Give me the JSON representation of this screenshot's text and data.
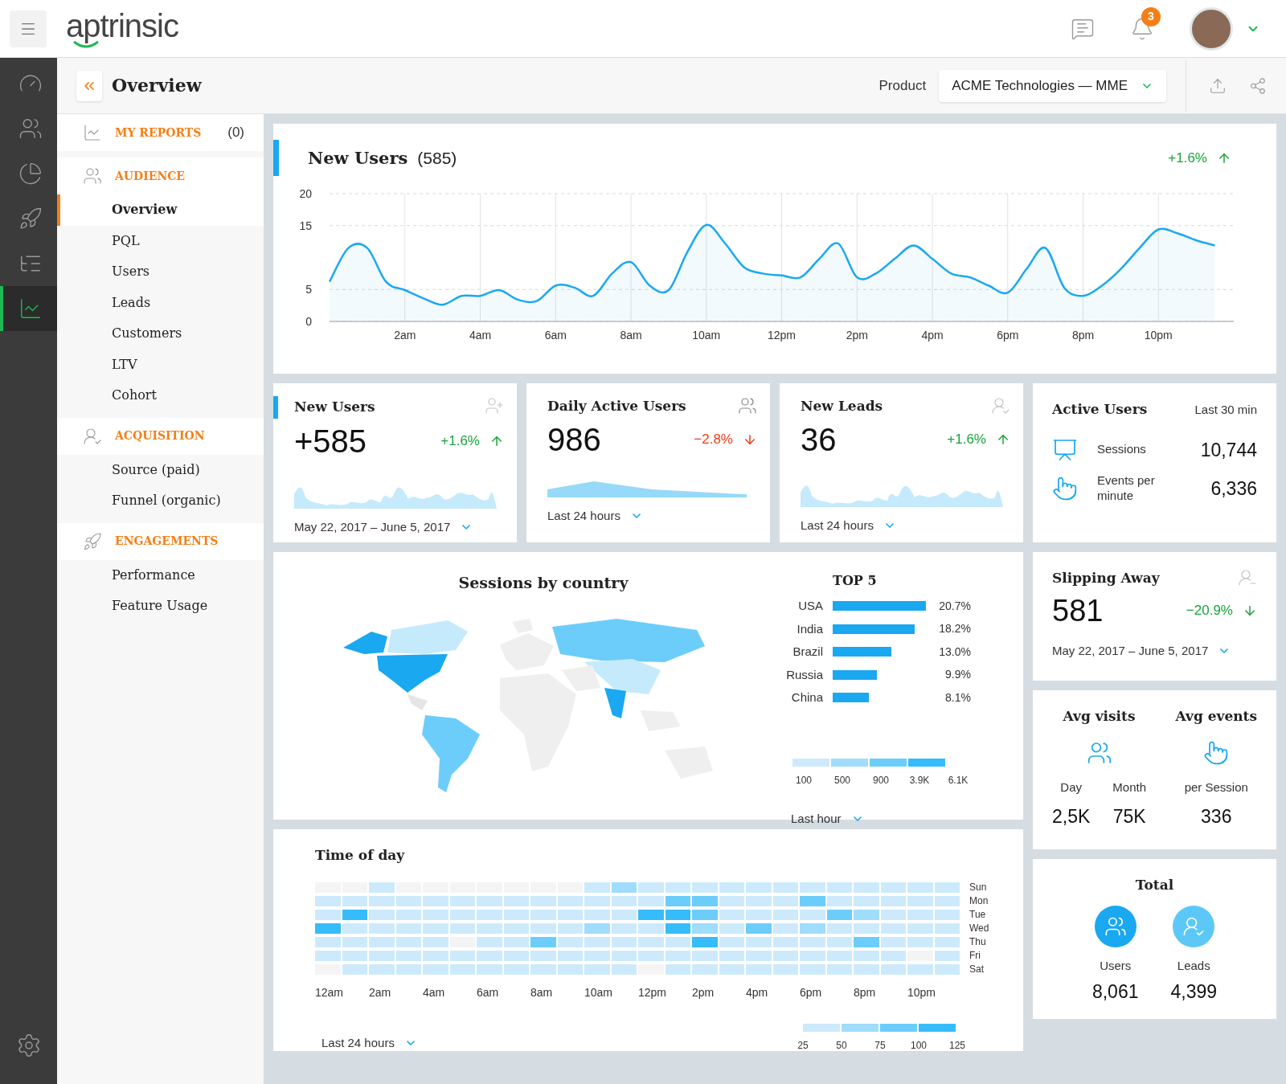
{
  "header": {
    "logo": "aptrinsic",
    "notifications": "3"
  },
  "rail": [
    {
      "selected": false
    },
    {
      "selected": false
    },
    {
      "selected": false
    },
    {
      "selected": false
    },
    {
      "selected": false
    },
    {
      "selected": true
    }
  ],
  "subheader": {
    "title": "Overview",
    "product_label": "Product",
    "product": "ACME Technologies — MME"
  },
  "nav": [
    {
      "label": "MY REPORTS",
      "count": "(0)"
    },
    {
      "label": "AUDIENCE",
      "items": [
        {
          "label": "Overview",
          "selected": true
        },
        {
          "label": "PQL",
          "selected": false
        },
        {
          "label": "Users",
          "selected": false
        },
        {
          "label": "Leads",
          "selected": false
        },
        {
          "label": "Customers",
          "selected": false
        },
        {
          "label": "LTV",
          "selected": false
        },
        {
          "label": "Cohort",
          "selected": false
        }
      ]
    },
    {
      "label": "ACQUISITION",
      "items": [
        {
          "label": "Source (paid)",
          "selected": false
        },
        {
          "label": "Funnel (organic)",
          "selected": false
        }
      ]
    },
    {
      "label": "ENGAGEMENTS",
      "items": [
        {
          "label": "Performance",
          "selected": false
        },
        {
          "label": "Feature Usage",
          "selected": false
        }
      ]
    }
  ],
  "main_chart": {
    "title": "New Users",
    "count": "(585)",
    "delta": "+1.6%",
    "rising": true,
    "good": true,
    "chart_data": {
      "type": "area",
      "categories": [
        null,
        null,
        null,
        null,
        "2am",
        null,
        null,
        null,
        "4am",
        null,
        null,
        null,
        "6am",
        null,
        null,
        null,
        "8am",
        null,
        null,
        null,
        "10am",
        null,
        null,
        null,
        "12pm",
        null,
        null,
        null,
        "2pm",
        null,
        null,
        null,
        "4pm",
        null,
        null,
        null,
        "6pm",
        null,
        null,
        null,
        "8pm",
        null,
        null,
        null,
        "10pm",
        null,
        null,
        null
      ],
      "series": [
        {
          "color": "#1aa8f0",
          "values": [
            6.2,
            11.5,
            11.5,
            6.2,
            4.9,
            3.6,
            2.6,
            4.0,
            4.0,
            4.9,
            3.4,
            3.2,
            5.6,
            5.3,
            4.0,
            7.5,
            9.3,
            5.6,
            4.9,
            10.9,
            15.1,
            12.2,
            8.5,
            7.5,
            7.2,
            6.9,
            9.8,
            12.2,
            6.9,
            7.5,
            9.8,
            11.9,
            9.8,
            7.5,
            6.9,
            5.6,
            4.5,
            8.2,
            11.5,
            5.3,
            4.0,
            5.6,
            8.2,
            11.5,
            14.4,
            13.8,
            12.7,
            11.9
          ]
        }
      ],
      "ylim": [
        0,
        20
      ],
      "yticks": [
        {
          "value": 0,
          "label": "0"
        },
        {
          "value": 5,
          "label": "5"
        },
        {
          "value": 15,
          "label": "15"
        },
        {
          "value": 20,
          "label": "20"
        }
      ],
      "grid": true
    }
  },
  "stat_cards": [
    {
      "title": "New Users",
      "value": "+585",
      "delta": "+1.6%",
      "rising": true,
      "good": true,
      "range": "May 22, 2017 – June 5, 2017"
    },
    {
      "title": "Daily Active Users",
      "value": "986",
      "delta": "−2.8%",
      "rising": false,
      "good": false,
      "range": "Last 24 hours"
    },
    {
      "title": "New Leads",
      "value": "36",
      "delta": "+1.6%",
      "rising": true,
      "good": true,
      "range": "Last 24 hours"
    }
  ],
  "active_users": {
    "title": "Active Users",
    "period": "Last 30 min",
    "rows": [
      {
        "label": "Sessions",
        "value": "10,744"
      },
      {
        "label": "Events per minute",
        "value": "6,336"
      }
    ]
  },
  "sessions_map": {
    "title": "Sessions by country",
    "legend": [
      "100",
      "500",
      "900",
      "3.9K",
      "6.1K"
    ],
    "range": "Last hour",
    "chart_data": {
      "type": "bar",
      "orientation": "horizontal",
      "title": "TOP 5",
      "categories": [
        "USA",
        "India",
        "Brazil",
        "Russia",
        "China"
      ],
      "values": [
        20.7,
        18.2,
        13.0,
        9.9,
        8.1
      ],
      "value_labels": [
        "20.7%",
        "18.2%",
        "13.0%",
        "9.9%",
        "8.1%"
      ]
    }
  },
  "slipping_away": {
    "title": "Slipping Away",
    "value": "581",
    "delta": "−20.9%",
    "rising": false,
    "good": true,
    "range": "May 22, 2017 – June 5, 2017"
  },
  "averages": {
    "groups": [
      {
        "title": "Avg visits",
        "items": [
          {
            "label": "Day",
            "value": "2,5K"
          },
          {
            "label": "Month",
            "value": "75K"
          }
        ]
      },
      {
        "title": "Avg events",
        "items": [
          {
            "label": "per Session",
            "value": "336"
          }
        ]
      }
    ]
  },
  "total": {
    "title": "Total",
    "items": [
      {
        "label": "Users",
        "value": "8,061"
      },
      {
        "label": "Leads",
        "value": "4,399"
      }
    ]
  },
  "time_of_day": {
    "title": "Time of day",
    "range": "Last 24 hours",
    "legend": [
      "25",
      "50",
      "75",
      "100",
      "125"
    ],
    "hours": [
      "12am",
      "2am",
      "4am",
      "6am",
      "8am",
      "10am",
      "12pm",
      "2pm",
      "4pm",
      "6pm",
      "8pm",
      "10pm"
    ],
    "rows": [
      {
        "day": "Sun",
        "cells": [
          {
            "color": "#f4f4f4"
          },
          {
            "color": "#f4f4f4"
          },
          {
            "color": "#cdeafc"
          },
          {
            "color": "#f4f4f4"
          },
          {
            "color": "#f4f4f4"
          },
          {
            "color": "#f4f4f4"
          },
          {
            "color": "#f4f4f4"
          },
          {
            "color": "#f4f4f4"
          },
          {
            "color": "#f4f4f4"
          },
          {
            "color": "#f4f4f4"
          },
          {
            "color": "#cdeafc"
          },
          {
            "color": "#a0dcfb"
          },
          {
            "color": "#cdeafc"
          },
          {
            "color": "#cdeafc"
          },
          {
            "color": "#cdeafc"
          },
          {
            "color": "#cdeafc"
          },
          {
            "color": "#cdeafc"
          },
          {
            "color": "#cdeafc"
          },
          {
            "color": "#cdeafc"
          },
          {
            "color": "#cdeafc"
          },
          {
            "color": "#cdeafc"
          },
          {
            "color": "#cdeafc"
          },
          {
            "color": "#cdeafc"
          },
          {
            "color": "#cdeafc"
          }
        ]
      },
      {
        "day": "Mon",
        "cells": [
          {
            "color": "#cdeafc"
          },
          {
            "color": "#cdeafc"
          },
          {
            "color": "#cdeafc"
          },
          {
            "color": "#cdeafc"
          },
          {
            "color": "#cdeafc"
          },
          {
            "color": "#cdeafc"
          },
          {
            "color": "#cdeafc"
          },
          {
            "color": "#cdeafc"
          },
          {
            "color": "#cdeafc"
          },
          {
            "color": "#cdeafc"
          },
          {
            "color": "#cdeafc"
          },
          {
            "color": "#cdeafc"
          },
          {
            "color": "#cdeafc"
          },
          {
            "color": "#6ccdfb"
          },
          {
            "color": "#6ccdfb"
          },
          {
            "color": "#cdeafc"
          },
          {
            "color": "#cdeafc"
          },
          {
            "color": "#cdeafc"
          },
          {
            "color": "#6ccdfb"
          },
          {
            "color": "#cdeafc"
          },
          {
            "color": "#cdeafc"
          },
          {
            "color": "#cdeafc"
          },
          {
            "color": "#cdeafc"
          },
          {
            "color": "#cdeafc"
          }
        ]
      },
      {
        "day": "Tue",
        "cells": [
          {
            "color": "#cdeafc"
          },
          {
            "color": "#36bcfa"
          },
          {
            "color": "#cdeafc"
          },
          {
            "color": "#cdeafc"
          },
          {
            "color": "#cdeafc"
          },
          {
            "color": "#cdeafc"
          },
          {
            "color": "#cdeafc"
          },
          {
            "color": "#cdeafc"
          },
          {
            "color": "#cdeafc"
          },
          {
            "color": "#cdeafc"
          },
          {
            "color": "#cdeafc"
          },
          {
            "color": "#cdeafc"
          },
          {
            "color": "#36bcfa"
          },
          {
            "color": "#36bcfa"
          },
          {
            "color": "#6ccdfb"
          },
          {
            "color": "#cdeafc"
          },
          {
            "color": "#cdeafc"
          },
          {
            "color": "#cdeafc"
          },
          {
            "color": "#cdeafc"
          },
          {
            "color": "#6ccdfb"
          },
          {
            "color": "#a0dcfb"
          },
          {
            "color": "#cdeafc"
          },
          {
            "color": "#cdeafc"
          },
          {
            "color": "#cdeafc"
          }
        ]
      },
      {
        "day": "Wed",
        "cells": [
          {
            "color": "#36bcfa"
          },
          {
            "color": "#cdeafc"
          },
          {
            "color": "#cdeafc"
          },
          {
            "color": "#cdeafc"
          },
          {
            "color": "#cdeafc"
          },
          {
            "color": "#cdeafc"
          },
          {
            "color": "#cdeafc"
          },
          {
            "color": "#cdeafc"
          },
          {
            "color": "#cdeafc"
          },
          {
            "color": "#cdeafc"
          },
          {
            "color": "#a0dcfb"
          },
          {
            "color": "#cdeafc"
          },
          {
            "color": "#cdeafc"
          },
          {
            "color": "#36bcfa"
          },
          {
            "color": "#a0dcfb"
          },
          {
            "color": "#cdeafc"
          },
          {
            "color": "#6ccdfb"
          },
          {
            "color": "#cdeafc"
          },
          {
            "color": "#a0dcfb"
          },
          {
            "color": "#cdeafc"
          },
          {
            "color": "#cdeafc"
          },
          {
            "color": "#cdeafc"
          },
          {
            "color": "#cdeafc"
          },
          {
            "color": "#cdeafc"
          }
        ]
      },
      {
        "day": "Thu",
        "cells": [
          {
            "color": "#cdeafc"
          },
          {
            "color": "#cdeafc"
          },
          {
            "color": "#cdeafc"
          },
          {
            "color": "#cdeafc"
          },
          {
            "color": "#cdeafc"
          },
          {
            "color": "#f4f4f4"
          },
          {
            "color": "#cdeafc"
          },
          {
            "color": "#cdeafc"
          },
          {
            "color": "#6ccdfb"
          },
          {
            "color": "#cdeafc"
          },
          {
            "color": "#cdeafc"
          },
          {
            "color": "#cdeafc"
          },
          {
            "color": "#cdeafc"
          },
          {
            "color": "#cdeafc"
          },
          {
            "color": "#36bcfa"
          },
          {
            "color": "#cdeafc"
          },
          {
            "color": "#cdeafc"
          },
          {
            "color": "#cdeafc"
          },
          {
            "color": "#cdeafc"
          },
          {
            "color": "#cdeafc"
          },
          {
            "color": "#6ccdfb"
          },
          {
            "color": "#cdeafc"
          },
          {
            "color": "#cdeafc"
          },
          {
            "color": "#cdeafc"
          }
        ]
      },
      {
        "day": "Fri",
        "cells": [
          {
            "color": "#cdeafc"
          },
          {
            "color": "#cdeafc"
          },
          {
            "color": "#cdeafc"
          },
          {
            "color": "#cdeafc"
          },
          {
            "color": "#cdeafc"
          },
          {
            "color": "#cdeafc"
          },
          {
            "color": "#cdeafc"
          },
          {
            "color": "#cdeafc"
          },
          {
            "color": "#cdeafc"
          },
          {
            "color": "#cdeafc"
          },
          {
            "color": "#cdeafc"
          },
          {
            "color": "#cdeafc"
          },
          {
            "color": "#cdeafc"
          },
          {
            "color": "#cdeafc"
          },
          {
            "color": "#cdeafc"
          },
          {
            "color": "#cdeafc"
          },
          {
            "color": "#cdeafc"
          },
          {
            "color": "#cdeafc"
          },
          {
            "color": "#cdeafc"
          },
          {
            "color": "#cdeafc"
          },
          {
            "color": "#cdeafc"
          },
          {
            "color": "#cdeafc"
          },
          {
            "color": "#f4f4f4"
          },
          {
            "color": "#cdeafc"
          }
        ]
      },
      {
        "day": "Sat",
        "cells": [
          {
            "color": "#f4f4f4"
          },
          {
            "color": "#cdeafc"
          },
          {
            "color": "#cdeafc"
          },
          {
            "color": "#cdeafc"
          },
          {
            "color": "#cdeafc"
          },
          {
            "color": "#cdeafc"
          },
          {
            "color": "#cdeafc"
          },
          {
            "color": "#cdeafc"
          },
          {
            "color": "#cdeafc"
          },
          {
            "color": "#cdeafc"
          },
          {
            "color": "#cdeafc"
          },
          {
            "color": "#cdeafc"
          },
          {
            "color": "#f4f4f4"
          },
          {
            "color": "#cdeafc"
          },
          {
            "color": "#cdeafc"
          },
          {
            "color": "#cdeafc"
          },
          {
            "color": "#cdeafc"
          },
          {
            "color": "#cdeafc"
          },
          {
            "color": "#cdeafc"
          },
          {
            "color": "#cdeafc"
          },
          {
            "color": "#cdeafc"
          },
          {
            "color": "#cdeafc"
          },
          {
            "color": "#cdeafc"
          },
          {
            "color": "#cdeafc"
          }
        ]
      }
    ]
  }
}
